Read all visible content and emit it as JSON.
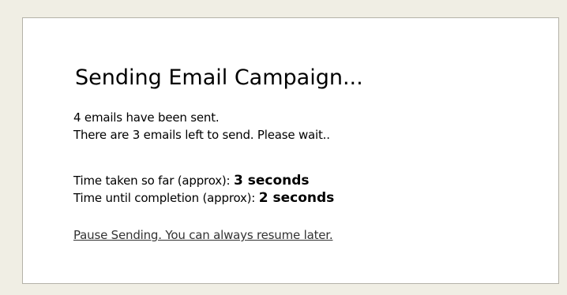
{
  "dialog": {
    "title": "Sending Email Campaign...",
    "sent_message": "4 emails have been sent.",
    "remaining_message": "There are 3 emails left to send. Please wait..",
    "time_taken_label": "Time taken so far (approx):",
    "time_taken_value": "3 seconds",
    "time_remaining_label": "Time until completion (approx):",
    "time_remaining_value": "2 seconds",
    "pause_link": "Pause Sending. You can always resume later."
  },
  "colors": {
    "background": "#f0eee4",
    "panel": "#ffffff",
    "panel_border": "#b4b2a8",
    "text": "#000000",
    "link": "#333333"
  }
}
